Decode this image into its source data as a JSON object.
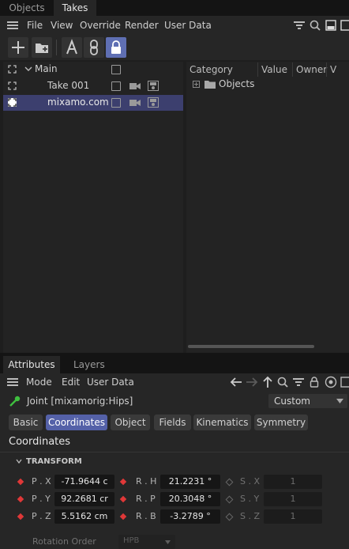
{
  "top_tabs": [
    "Objects",
    "Takes"
  ],
  "menubar": {
    "items": [
      "File",
      "View",
      "Override",
      "Render",
      "User Data"
    ]
  },
  "takes": {
    "root": "Main",
    "items": [
      {
        "label": "Take 001",
        "selected": false
      },
      {
        "label": "mixamo.com",
        "selected": true
      }
    ]
  },
  "overrides": {
    "columns": [
      "Category",
      "Value",
      "Owner",
      "V"
    ],
    "tree_item": "Objects"
  },
  "attributes": {
    "tabs": [
      "Attributes",
      "Layers"
    ],
    "menu": [
      "Mode",
      "Edit",
      "User Data"
    ],
    "object_title": "Joint [mixamorig:Hips]",
    "preset": "Custom",
    "pill_tabs": [
      "Basic",
      "Coordinates",
      "Object",
      "Fields",
      "Kinematics",
      "Symmetry"
    ],
    "active_pill": "Coordinates",
    "section_title": "Coordinates",
    "group_title": "TRANSFORM",
    "rows": [
      {
        "p_label": "P . X",
        "p_value": "-71.9644 c",
        "r_label": "R . H",
        "r_value": "21.2231 °",
        "s_label": "S . X",
        "s_value": "1"
      },
      {
        "p_label": "P . Y",
        "p_value": "92.2681 cr",
        "r_label": "R . P",
        "r_value": "20.3048 °",
        "s_label": "S . Y",
        "s_value": "1"
      },
      {
        "p_label": "P . Z",
        "p_value": "5.5162 cm",
        "r_label": "R . B",
        "r_value": "-3.2789 °",
        "s_label": "S . Z",
        "s_value": "1"
      }
    ],
    "rotation_order_label": "Rotation Order",
    "rotation_order_value": "HPB"
  },
  "colors": {
    "accent": "#5461a8",
    "selection": "#3c3f6e",
    "keyframe": "#e03838",
    "joint_icon": "#3fbf3f"
  }
}
